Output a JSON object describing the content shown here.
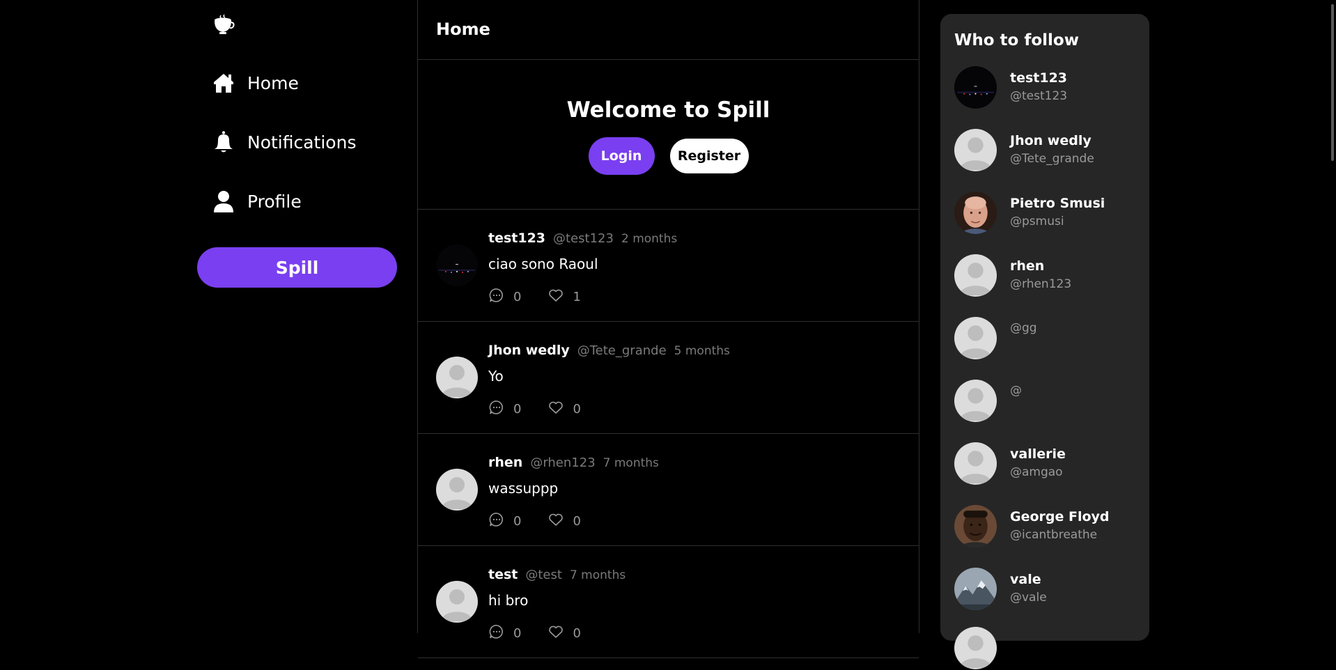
{
  "sidebar": {
    "logo_icon": "teacup-icon",
    "nav": [
      {
        "label": "Home",
        "icon": "home-icon"
      },
      {
        "label": "Notifications",
        "icon": "bell-icon"
      },
      {
        "label": "Profile",
        "icon": "user-icon"
      }
    ],
    "spill_label": "Spill"
  },
  "header": {
    "title": "Home"
  },
  "welcome": {
    "title": "Welcome to Spill",
    "login_label": "Login",
    "register_label": "Register"
  },
  "posts": [
    {
      "name": "test123",
      "handle": "@test123",
      "time": "2 months",
      "text": "ciao sono Raoul",
      "comments": "0",
      "likes": "1",
      "avatar": "night-photo"
    },
    {
      "name": "Jhon wedly",
      "handle": "@Tete_grande",
      "time": "5 months",
      "text": "Yo",
      "comments": "0",
      "likes": "0",
      "avatar": "default"
    },
    {
      "name": "rhen",
      "handle": "@rhen123",
      "time": "7 months",
      "text": "wassuppp",
      "comments": "0",
      "likes": "0",
      "avatar": "default"
    },
    {
      "name": "test",
      "handle": "@test",
      "time": "7 months",
      "text": "hi bro",
      "comments": "0",
      "likes": "0",
      "avatar": "default"
    }
  ],
  "who_to_follow": {
    "title": "Who to follow",
    "users": [
      {
        "name": "test123",
        "handle": "@test123",
        "avatar": "night-photo"
      },
      {
        "name": "Jhon wedly",
        "handle": "@Tete_grande",
        "avatar": "default"
      },
      {
        "name": "Pietro Smusi",
        "handle": "@psmusi",
        "avatar": "bald-man-photo"
      },
      {
        "name": "rhen",
        "handle": "@rhen123",
        "avatar": "default"
      },
      {
        "name": "",
        "handle": "@gg",
        "avatar": "default"
      },
      {
        "name": "",
        "handle": "@",
        "avatar": "default"
      },
      {
        "name": "vallerie",
        "handle": "@amgao",
        "avatar": "default"
      },
      {
        "name": "George Floyd",
        "handle": "@icantbreathe",
        "avatar": "man-photo"
      },
      {
        "name": "vale",
        "handle": "@vale",
        "avatar": "mountain-photo"
      }
    ]
  },
  "colors": {
    "accent": "#7a3ff0",
    "background": "#000000",
    "panel": "#262626",
    "muted_text": "#7a7a7a"
  }
}
